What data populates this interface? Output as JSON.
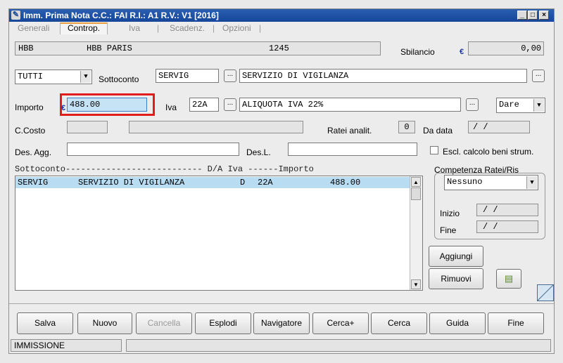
{
  "window": {
    "title": "Imm. Prima Nota C.C.: FAI  R.I.: A1  R.V.: V1  [2016]",
    "minimize_glyph": "_",
    "maximize_glyph": "□",
    "close_glyph": "×"
  },
  "tabs": [
    "Generali",
    "Controp.",
    "Iva",
    "Scadenz.",
    "Opzioni"
  ],
  "tab_separator": "|",
  "header": {
    "code": "HBB",
    "name": "HBB PARIS",
    "number": "1245",
    "sbilancio_label": "Sbilancio",
    "sbilancio_value": "0,00",
    "currency_symbol": "€"
  },
  "form": {
    "filter_value": "TUTTI",
    "sottoconto_label": "Sottoconto",
    "sottoconto_code": "SERVIG",
    "sottoconto_desc": "SERVIZIO DI VIGILANZA",
    "importo_label": "Importo",
    "importo_value": "488.00",
    "iva_label": "Iva",
    "iva_code": "22A",
    "iva_desc": "ALIQUOTA IVA 22%",
    "dare_value": "Dare",
    "ccosto_label": "C.Costo",
    "ratei_label": "Ratei analit.",
    "ratei_value": "0",
    "da_data_label": "Da data",
    "da_data_value": "  /  /",
    "des_agg_label": "Des. Agg.",
    "des_l_label": "Des.L.",
    "escl_label": "Escl. calcolo beni strum.",
    "ellipsis": "..."
  },
  "grid": {
    "header": "Sottoconto--------------------------- D/A  Iva   ------Importo",
    "rows": [
      {
        "code": "SERVIG",
        "desc": "SERVIZIO DI VIGILANZA",
        "da": "D",
        "iva": "22A",
        "importo": "488.00"
      }
    ]
  },
  "competenza": {
    "label": "Competenza Ratei/Ris",
    "select_value": "Nessuno",
    "inizio_label": "Inizio",
    "inizio_value": "  /  /",
    "fine_label": "Fine",
    "fine_value": "  /  /"
  },
  "actions": {
    "aggiungi": "Aggiungi",
    "rimuovi": "Rimuovi"
  },
  "buttons": [
    "Salva",
    "Nuovo",
    "Cancella",
    "Esplodi",
    "Navigatore",
    "Cerca+",
    "Cerca",
    "Guida",
    "Fine"
  ],
  "status": {
    "mode": "IMMISSIONE",
    "message": ""
  }
}
